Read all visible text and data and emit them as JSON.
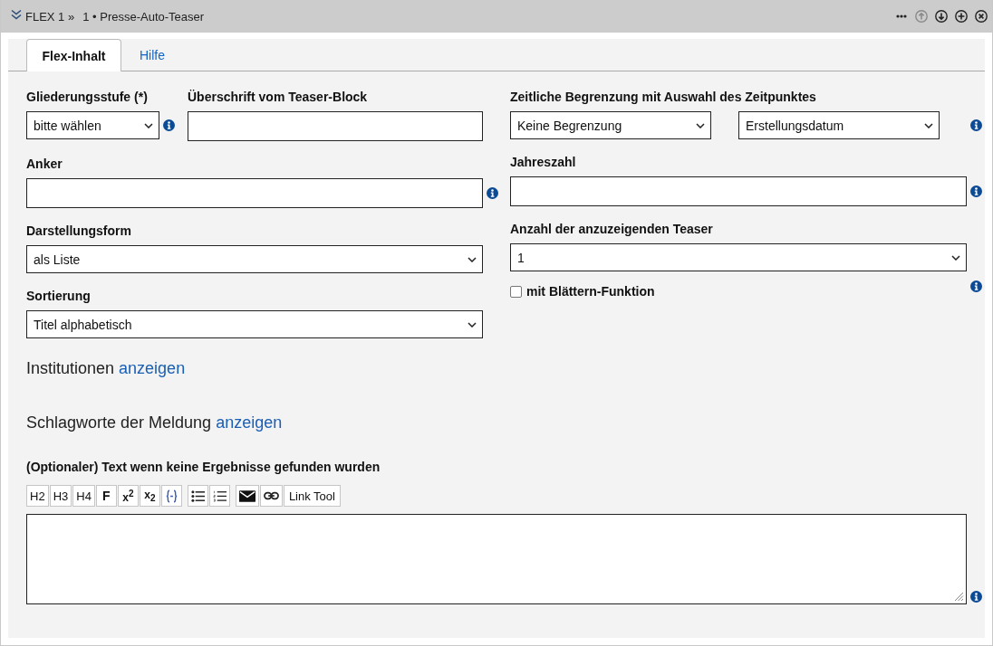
{
  "header": {
    "section": "FLEX 1 »",
    "title": "1 • Presse-Auto-Teaser",
    "actions": [
      {
        "kind": "more",
        "disabled": false
      },
      {
        "kind": "up",
        "disabled": true
      },
      {
        "kind": "down",
        "disabled": false
      },
      {
        "kind": "add",
        "disabled": false
      },
      {
        "kind": "remove",
        "disabled": false
      }
    ]
  },
  "tabs": [
    {
      "label": "Flex-Inhalt",
      "selected": true
    },
    {
      "label": "Hilfe",
      "selected": false
    }
  ],
  "form": {
    "left": [
      {
        "fields": [
          {
            "kind": "select",
            "label": "Gliederungsstufe (*)",
            "value": "bitte wählen",
            "info": true
          },
          {
            "kind": "text",
            "label": "Überschrift vom Teaser-Block",
            "info": false
          }
        ]
      },
      {
        "fields": [
          {
            "kind": "text",
            "label": "Anker",
            "info": true
          }
        ]
      },
      {
        "fields": [
          {
            "kind": "select",
            "label": "Darstellungsform",
            "value": "als Liste",
            "info": false
          }
        ]
      },
      {
        "fields": [
          {
            "kind": "select",
            "label": "Sortierung",
            "value": "Titel alphabetisch",
            "info": false
          }
        ]
      }
    ],
    "right": [
      {
        "fields": [
          {
            "kind": "select_pair",
            "label": "Zeitliche Begrenzung mit Auswahl des Zeitpunktes",
            "values": [
              "Keine Begrenzung",
              "Erstellungsdatum"
            ],
            "info": true
          }
        ]
      },
      {
        "fields": [
          {
            "kind": "text",
            "label": "Jahreszahl",
            "info": true
          }
        ]
      },
      {
        "fields": [
          {
            "kind": "select",
            "label": "Anzahl der anzuzeigenden Teaser",
            "value": "1",
            "info": false
          }
        ]
      },
      {
        "fields": [
          {
            "kind": "checkbox",
            "label": "mit Blättern-Funktion",
            "checked": false,
            "info": true
          }
        ]
      }
    ]
  },
  "sections": [
    {
      "text": "Institutionen",
      "link": "anzeigen"
    },
    {
      "text": "Schlagworte der Meldung",
      "link": "anzeigen"
    }
  ],
  "editor": {
    "label": "(Optionaler) Text wenn keine Ergebnisse gefunden wurden",
    "toolbar": [
      {
        "buttons": [
          {
            "kind": "heading",
            "label": "H2"
          },
          {
            "kind": "heading",
            "label": "H3"
          },
          {
            "kind": "heading",
            "label": "H4"
          },
          {
            "kind": "strong",
            "label": "F"
          },
          {
            "kind": "sup",
            "label": "x$^{2}$"
          },
          {
            "kind": "sub",
            "label": "x$_{2}$"
          },
          {
            "kind": "braces"
          }
        ]
      },
      {
        "buttons": [
          {
            "kind": "bullets"
          },
          {
            "kind": "numbers"
          }
        ]
      },
      {
        "buttons": [
          {
            "kind": "mail"
          },
          {
            "kind": "chain"
          },
          {
            "kind": "tool",
            "label": "Link Tool"
          }
        ]
      }
    ],
    "info": true
  }
}
